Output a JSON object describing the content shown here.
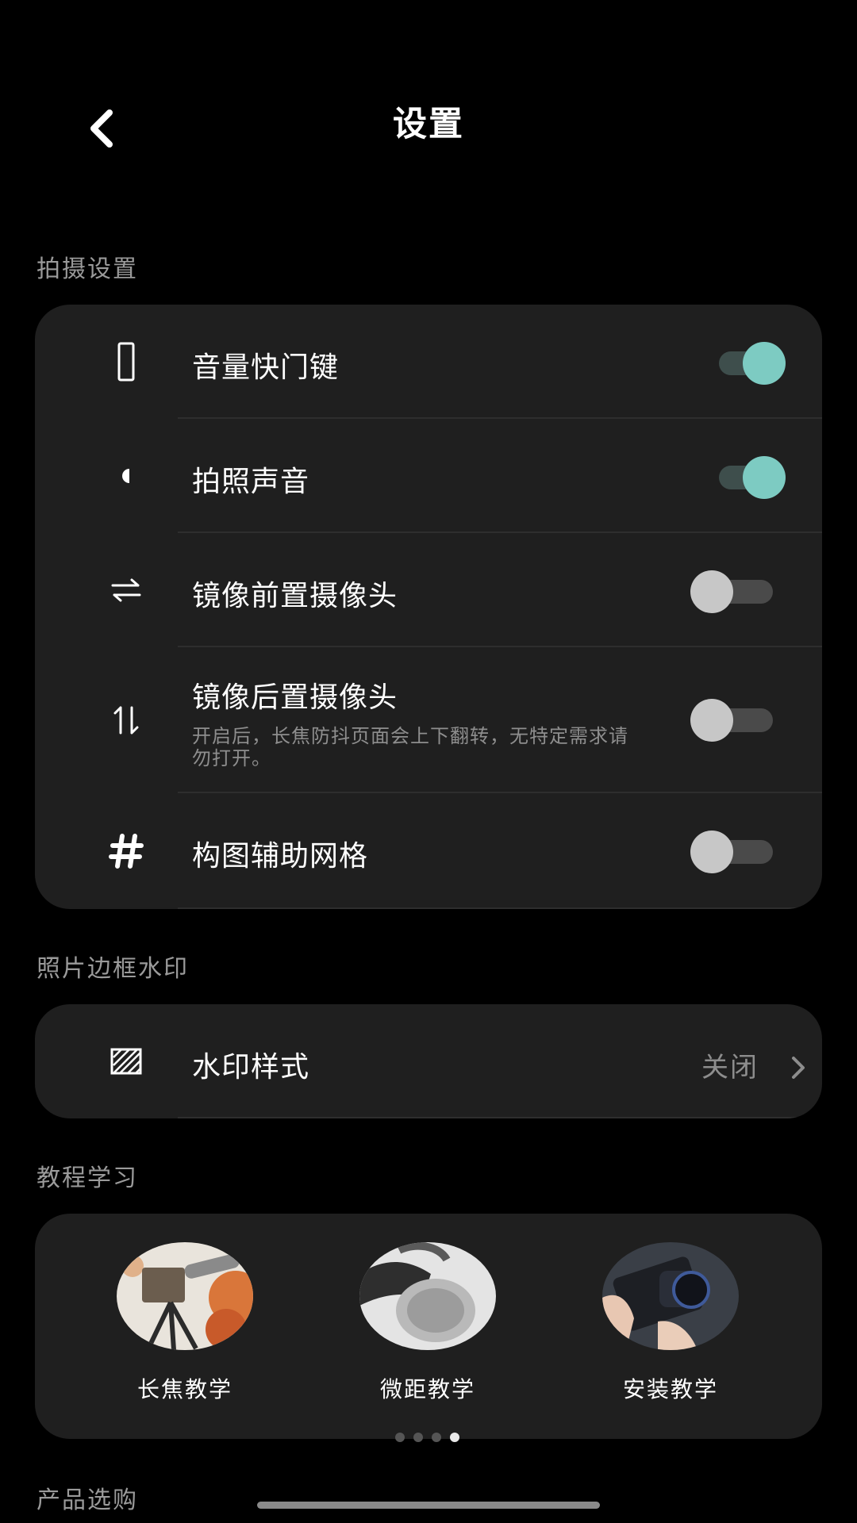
{
  "header": {
    "title": "设置"
  },
  "sections": {
    "shooting": {
      "title": "拍摄设置",
      "items": [
        {
          "label": "音量快门键",
          "toggle": "on",
          "icon": "phone-icon"
        },
        {
          "label": "拍照声音",
          "toggle": "on",
          "icon": "sound-icon"
        },
        {
          "label": "镜像前置摄像头",
          "toggle": "off",
          "icon": "horizontal-flip-icon"
        },
        {
          "label": "镜像后置摄像头",
          "sublabel": "开启后，长焦防抖页面会上下翻转，无特定需求请勿打开。",
          "toggle": "off",
          "icon": "vertical-flip-icon"
        },
        {
          "label": "构图辅助网格",
          "toggle": "off",
          "icon": "grid-hash-icon"
        }
      ]
    },
    "watermark": {
      "title": "照片边框水印",
      "item": {
        "label": "水印样式",
        "value": "关闭",
        "icon": "watermark-icon"
      }
    },
    "tutorials": {
      "title": "教程学习",
      "items": [
        {
          "label": "长焦教学"
        },
        {
          "label": "微距教学"
        },
        {
          "label": "安装教学"
        }
      ],
      "page_count": 4,
      "active_page": 4
    },
    "products": {
      "title": "产品选购"
    }
  },
  "colors": {
    "background": "#000000",
    "card": "#1f1f1f",
    "toggle_on": "#7dcbc2",
    "toggle_off": "#c7c7c7"
  }
}
